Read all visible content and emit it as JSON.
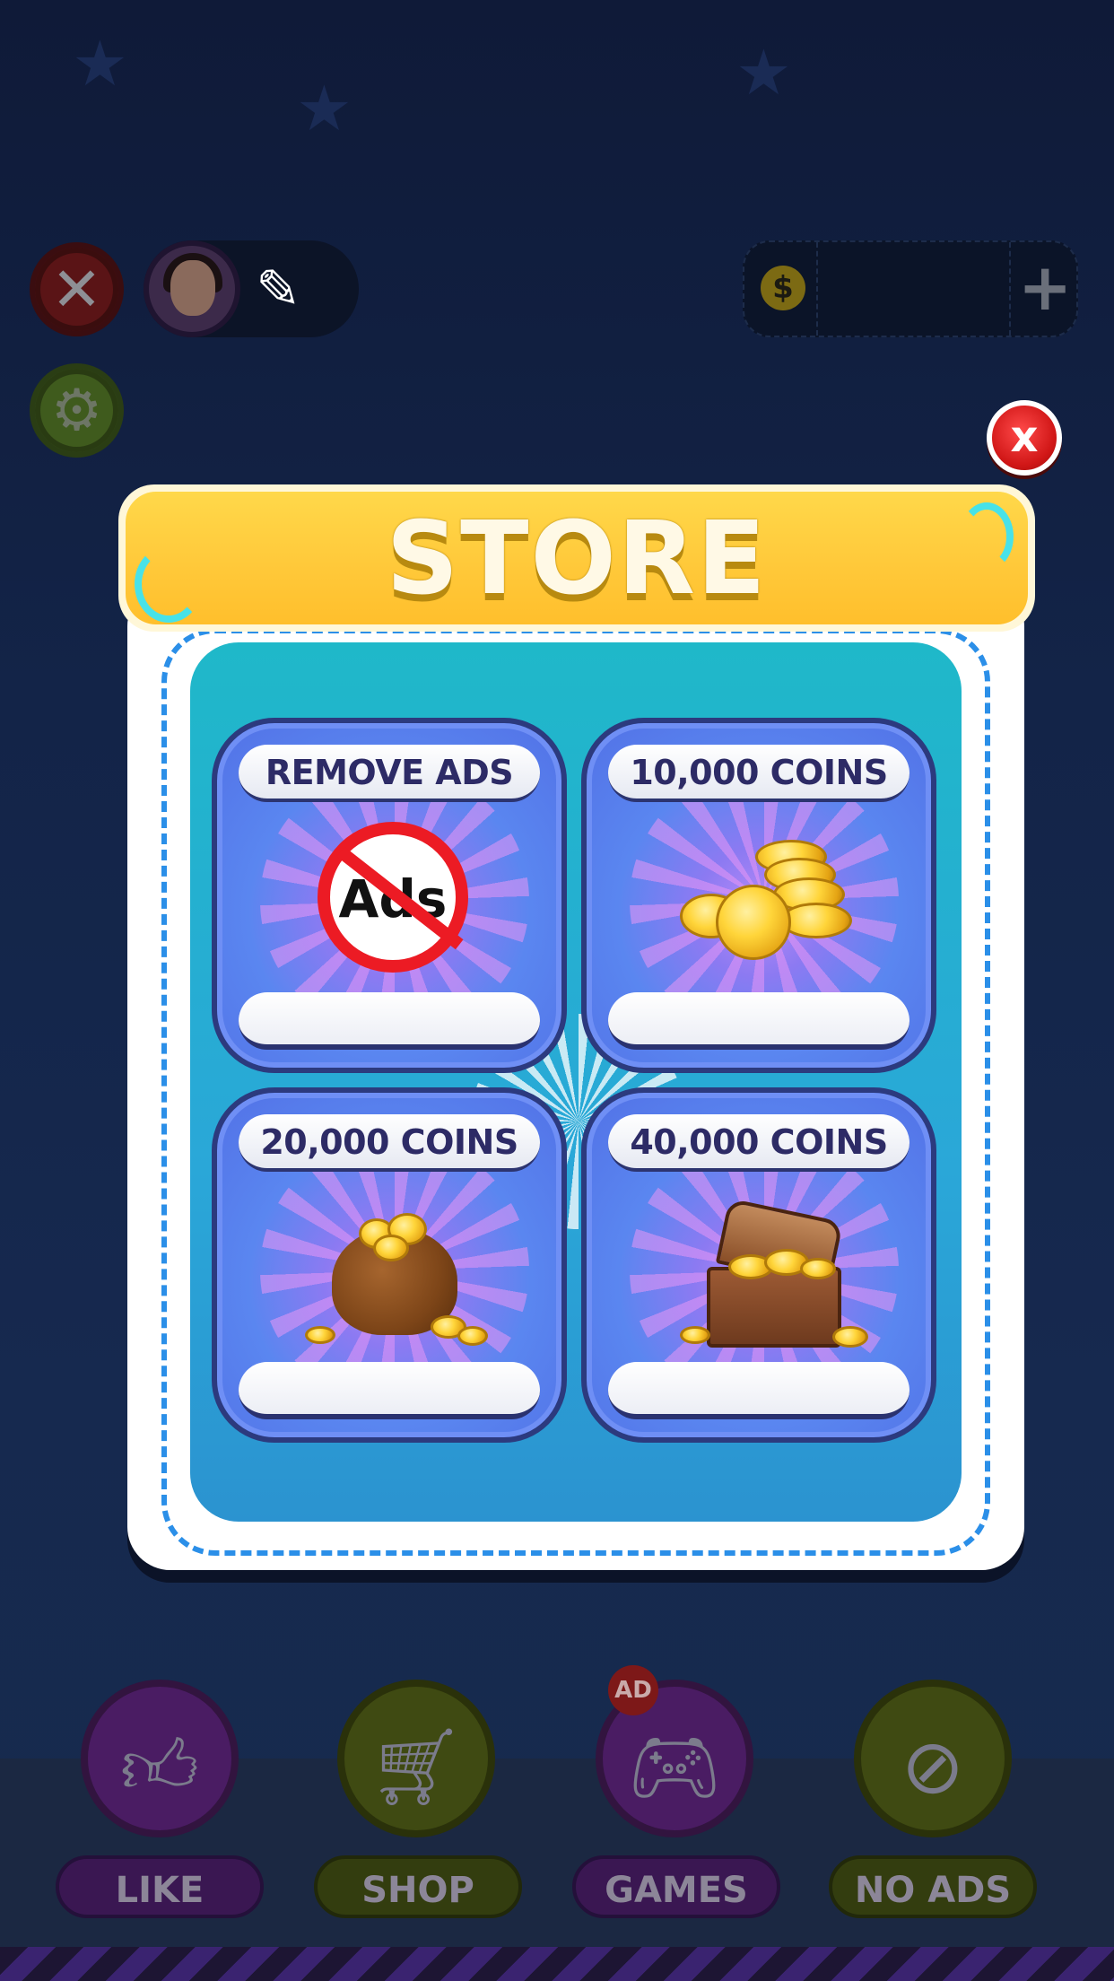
{
  "store": {
    "title": "STORE",
    "close_symbol": "x",
    "items": [
      {
        "label": "REMOVE ADS",
        "art": "no-ads-icon",
        "price": ""
      },
      {
        "label": "10,000 COINS",
        "art": "coin-stack-icon",
        "price": ""
      },
      {
        "label": "20,000 COINS",
        "art": "coin-bag-icon",
        "price": ""
      },
      {
        "label": "40,000 COINS",
        "art": "treasure-chest-icon",
        "price": ""
      }
    ],
    "colors": {
      "banner": "#ffc93a",
      "close": "#d01616",
      "panel": "#2aa7d8",
      "dash": "#2b8fe8"
    }
  },
  "background": {
    "coin_symbol": "$",
    "add_symbol": "+",
    "nav": [
      {
        "label": "LIKE",
        "icon": "thumbs-up-icon"
      },
      {
        "label": "SHOP",
        "icon": "cart-icon"
      },
      {
        "label": "GAMES",
        "icon": "gamepad-icon",
        "badge": "AD"
      },
      {
        "label": "NO ADS",
        "icon": "no-ads-icon"
      }
    ]
  }
}
